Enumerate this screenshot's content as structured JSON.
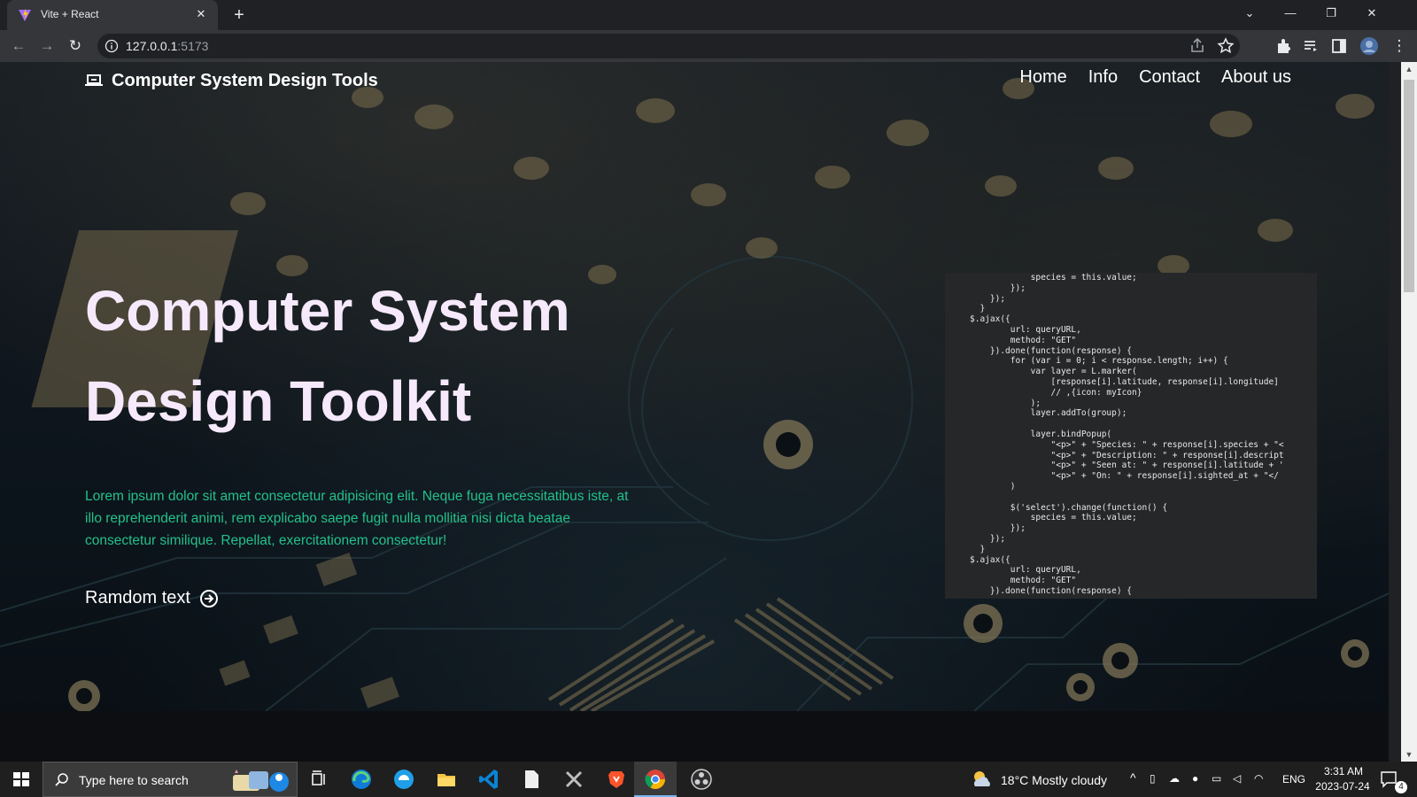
{
  "browser": {
    "tab_title": "Vite + React",
    "tab_close": "✕",
    "new_tab": "+",
    "url_host": "127.0.0.1",
    "url_port": ":5173"
  },
  "site": {
    "brand": "Computer System Design Tools",
    "nav": [
      "Home",
      "Info",
      "Contact",
      "About us"
    ]
  },
  "hero": {
    "title_line1": "Computer System",
    "title_line2": "Design Toolkit",
    "body": "Lorem ipsum dolor sit amet consectetur adipisicing elit. Neque fuga necessitatibus iste, at illo reprehenderit animi, rem explicabo saepe fugit nulla mollitia nisi dicta beatae consectetur similique. Repellat, exercitationem consectetur!",
    "cta": "Ramdom text"
  },
  "code_lines": [
    "            species = this.value;",
    "        });",
    "    });",
    "  }",
    "$.ajax({",
    "        url: queryURL,",
    "        method: \"GET\"",
    "    }).done(function(response) {",
    "        for (var i = 0; i < response.length; i++) {",
    "            var layer = L.marker(",
    "                [response[i].latitude, response[i].longitude]",
    "                // ,{icon: myIcon}",
    "            );",
    "            layer.addTo(group);",
    "",
    "            layer.bindPopup(",
    "                \"<p>\" + \"Species: \" + response[i].species + \"<",
    "                \"<p>\" + \"Description: \" + response[i].descript",
    "                \"<p>\" + \"Seen at: \" + response[i].latitude + '",
    "                \"<p>\" + \"On: \" + response[i].sighted_at + \"</",
    "        )",
    "",
    "        $('select').change(function() {",
    "            species = this.value;",
    "        });",
    "    });",
    "  }",
    "$.ajax({",
    "        url: queryURL,",
    "        method: \"GET\"",
    "    }).done(function(response) {"
  ],
  "taskbar": {
    "search_placeholder": "Type here to search",
    "weather": "18°C  Mostly cloudy",
    "language": "ENG",
    "time": "3:31 AM",
    "date": "2023-07-24",
    "notifications": "4"
  },
  "colors": {
    "hero_title": "#f6e9fb",
    "hero_body": "#23c18a",
    "code_bg": "#262729"
  }
}
